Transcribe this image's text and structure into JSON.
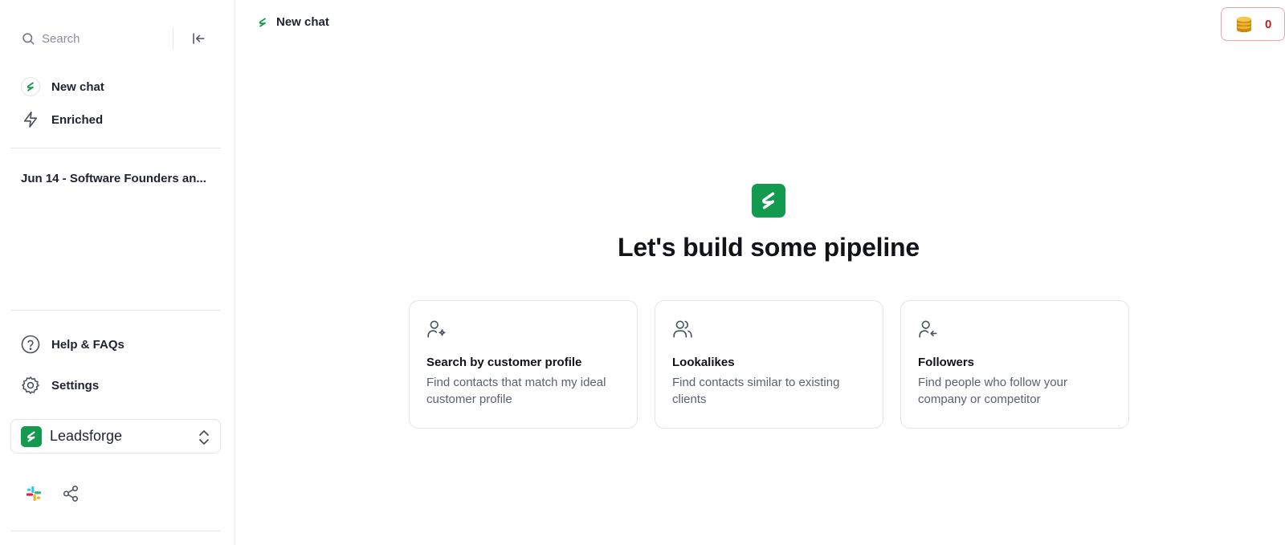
{
  "sidebar": {
    "search_placeholder": "Search",
    "nav": {
      "new_chat": "New chat",
      "enriched": "Enriched"
    },
    "history": [
      "Jun 14 - Software Founders an..."
    ],
    "help": "Help & FAQs",
    "settings": "Settings",
    "workspace": "Leadsforge"
  },
  "header": {
    "title": "New chat",
    "credits": "0"
  },
  "main": {
    "headline": "Let's build some pipeline",
    "cards": [
      {
        "title": "Search by customer profile",
        "desc": "Find contacts that match my ideal customer profile",
        "icon": "user-sparkle-icon"
      },
      {
        "title": "Lookalikes",
        "desc": "Find contacts similar to existing clients",
        "icon": "users-icon"
      },
      {
        "title": "Followers",
        "desc": "Find people who follow your company or competitor",
        "icon": "user-follow-icon"
      }
    ]
  },
  "colors": {
    "brand": "#129a4f",
    "credits_text": "#b42318",
    "credits_border": "#f1a3a3"
  }
}
